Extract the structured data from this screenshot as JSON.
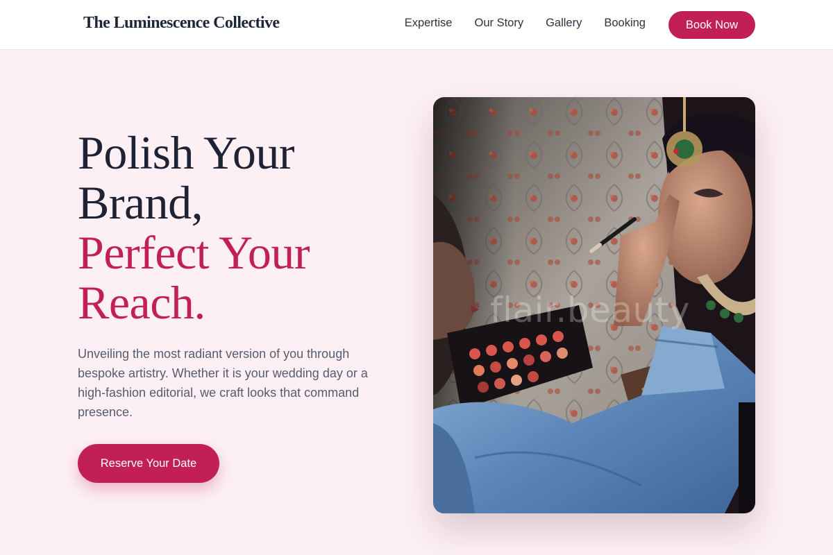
{
  "header": {
    "brand": "The Luminescence Collective",
    "nav": [
      {
        "label": "Expertise"
      },
      {
        "label": "Our Story"
      },
      {
        "label": "Gallery"
      },
      {
        "label": "Booking"
      }
    ],
    "cta_label": "Book Now"
  },
  "hero": {
    "headline_lines": [
      "Polish Your",
      "Brand,"
    ],
    "headline_accent_lines": [
      "Perfect Your",
      "Reach."
    ],
    "description": "Unveiling the most radiant version of you through bespoke artistry. Whether it is your wedding day or a high-fashion editorial, we craft looks that command presence.",
    "cta_label": "Reserve Your Date",
    "image": {
      "subject": "makeup artist applying eye makeup to a bride wearing jewelry",
      "watermark": "flair.beauty"
    }
  },
  "colors": {
    "accent": "#c21f58",
    "page_background": "#fdf0f5",
    "header_background": "#ffffff",
    "heading_text": "#1e2235",
    "body_text": "#565c6e"
  }
}
